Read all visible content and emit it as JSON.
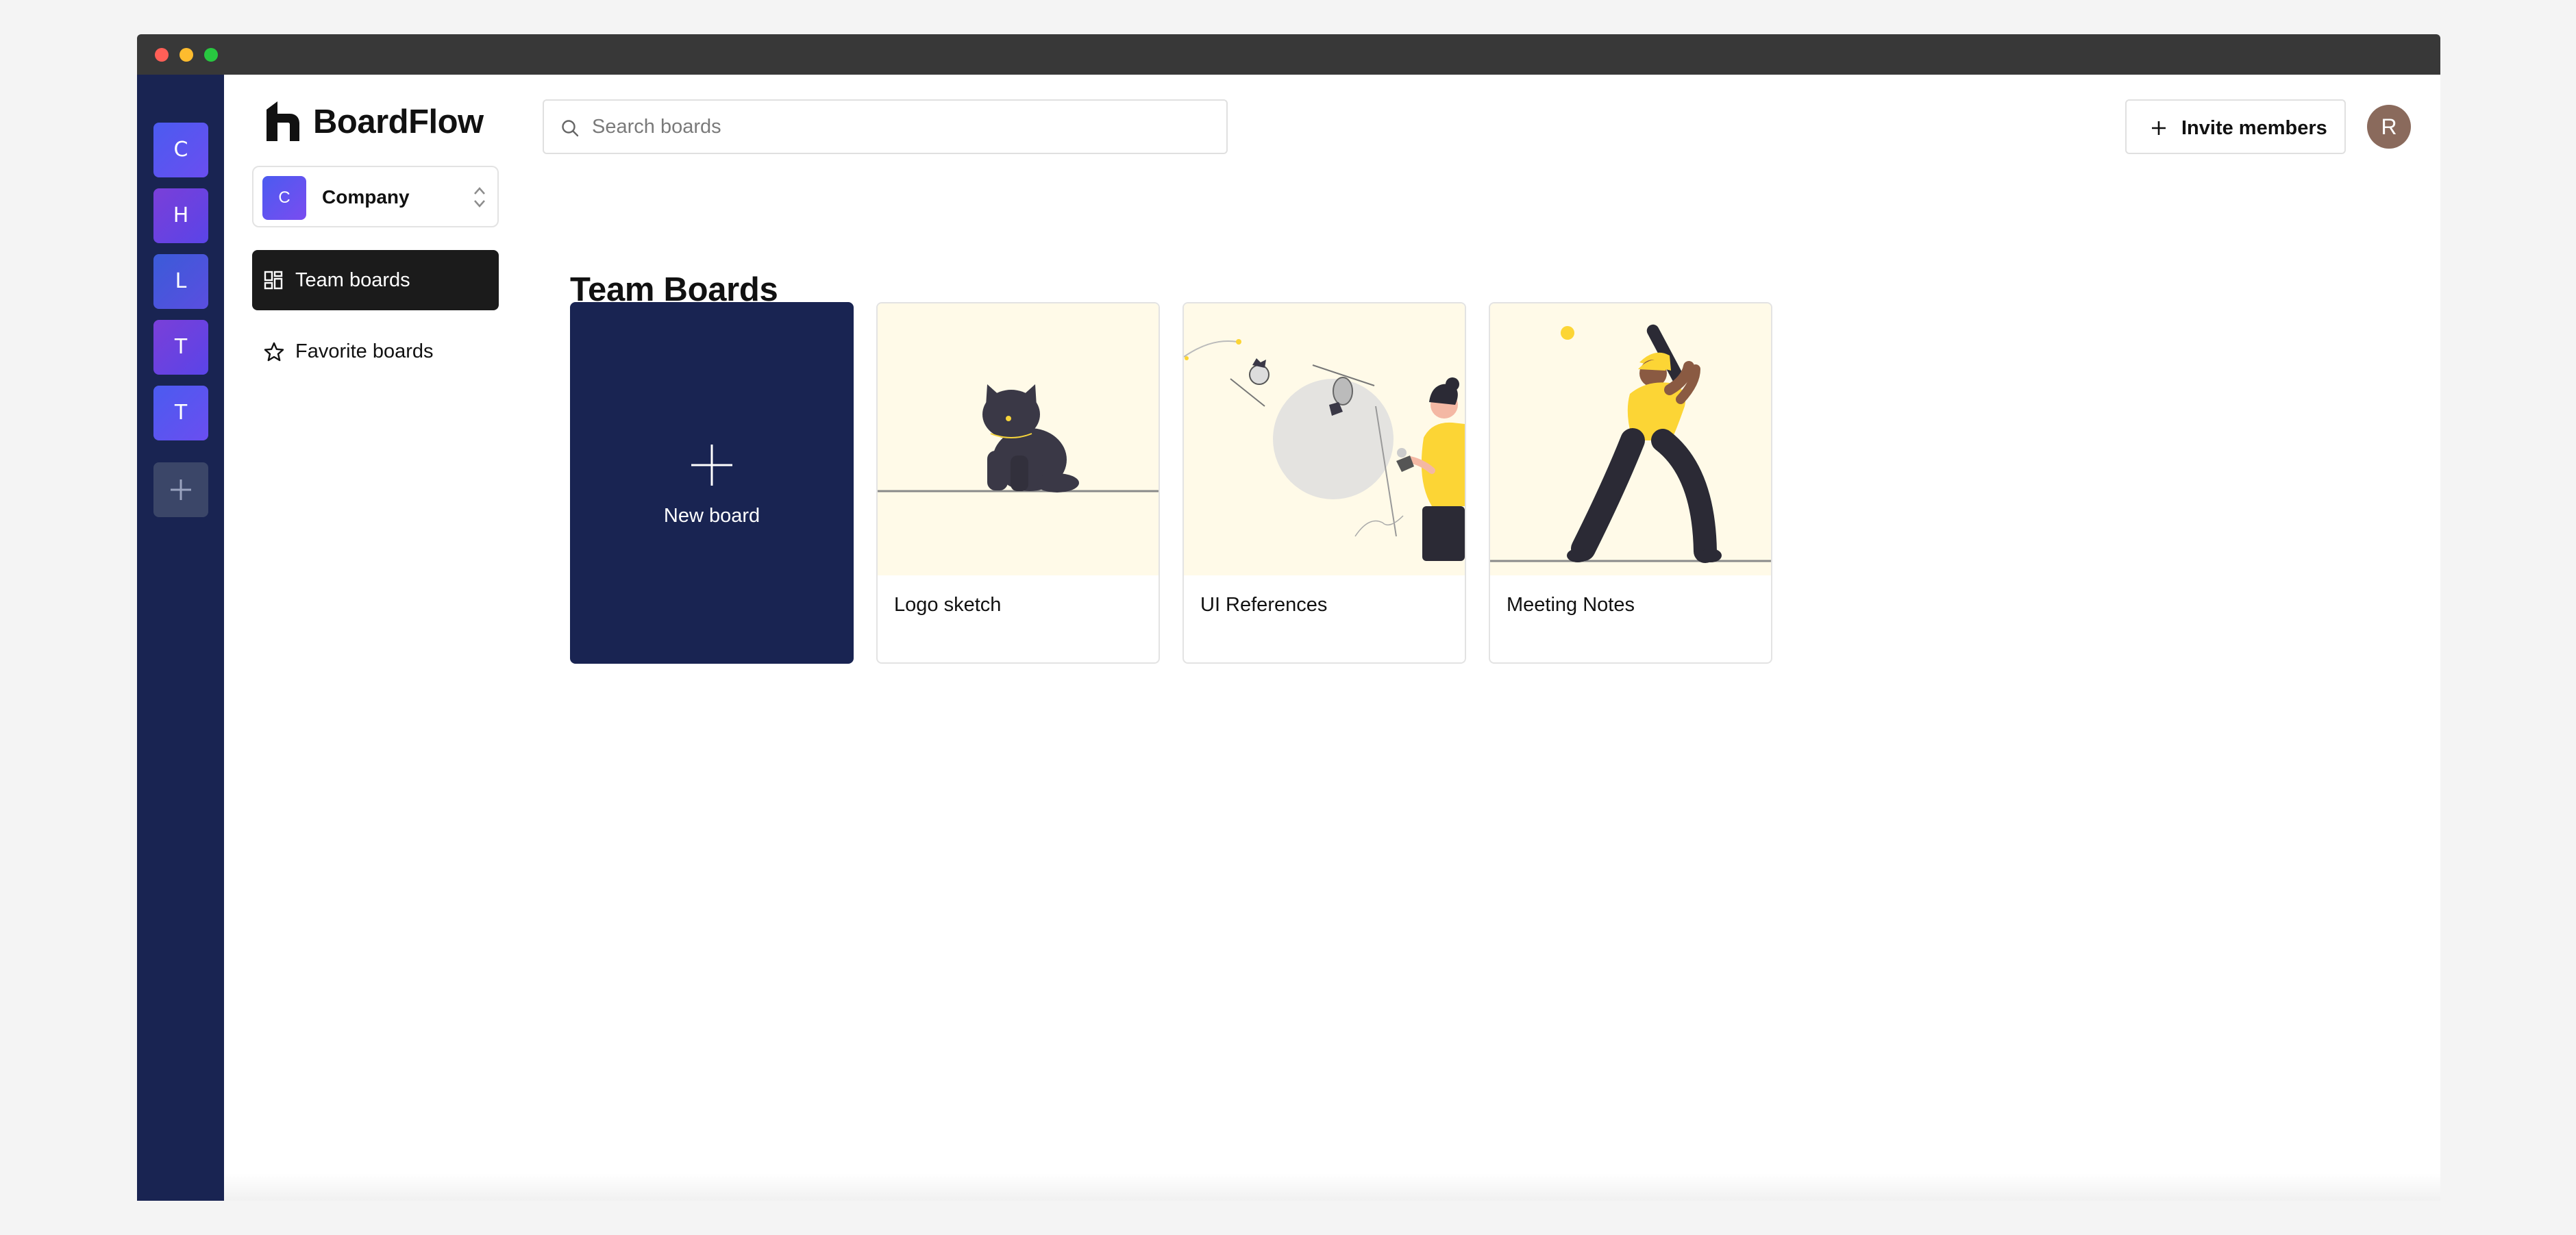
{
  "app": {
    "name": "BoardFlow"
  },
  "org_rail": {
    "orgs": [
      {
        "initial": "C",
        "gradient": [
          "#4b5bf0",
          "#6a4ef0"
        ]
      },
      {
        "initial": "H",
        "gradient": [
          "#7a3fd8",
          "#5a44e8"
        ]
      },
      {
        "initial": "L",
        "gradient": [
          "#3b5bd8",
          "#5a4ee0"
        ]
      },
      {
        "initial": "T",
        "gradient": [
          "#7a3fd8",
          "#5a44e8"
        ]
      },
      {
        "initial": "T",
        "gradient": [
          "#4b5bf0",
          "#6a4ef0"
        ]
      }
    ],
    "add_icon": "plus-icon"
  },
  "sidebar": {
    "team_switcher": {
      "initial": "C",
      "name": "Company",
      "icon": "chevron-up-down-icon"
    },
    "nav": [
      {
        "label": "Team boards",
        "icon": "grid-icon",
        "active": true
      },
      {
        "label": "Favorite boards",
        "icon": "star-icon",
        "active": false
      }
    ]
  },
  "header": {
    "search_placeholder": "Search boards",
    "search_icon": "search-icon",
    "invite_label": "Invite members",
    "invite_icon": "plus-icon",
    "user_initial": "R"
  },
  "main": {
    "title": "Team Boards",
    "new_board_label": "New board",
    "boards": [
      {
        "title": "Logo sketch",
        "illustration": "cat-illustration"
      },
      {
        "title": "UI References",
        "illustration": "woman-illustration"
      },
      {
        "title": "Meeting Notes",
        "illustration": "baseball-illustration"
      }
    ]
  },
  "colors": {
    "rail": "#192452",
    "accent_yellow": "#fcd535",
    "thumb_bg": "#fffae8",
    "active_nav": "#1b1b1b"
  }
}
